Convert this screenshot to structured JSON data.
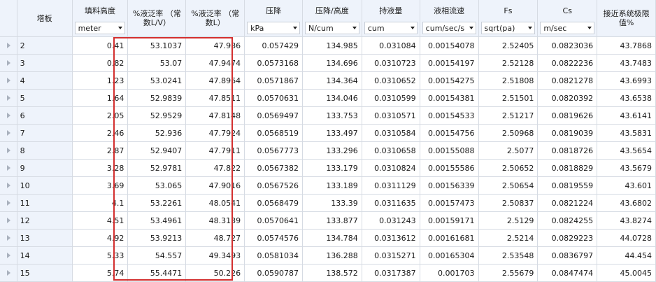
{
  "columns": [
    {
      "key": "stage",
      "title": "塔板",
      "unit": ""
    },
    {
      "key": "height",
      "title": "填料高度",
      "unit": "meter"
    },
    {
      "key": "flood1",
      "title": "%液泛率 （常数L/V）",
      "unit": ""
    },
    {
      "key": "flood2",
      "title": "%液泛率 （常数L）",
      "unit": ""
    },
    {
      "key": "dp",
      "title": "压降",
      "unit": "kPa"
    },
    {
      "key": "dph",
      "title": "压降/高度",
      "unit": "N/cum"
    },
    {
      "key": "holdup",
      "title": "持液量",
      "unit": "cum"
    },
    {
      "key": "liqv",
      "title": "液相流速",
      "unit": "cum/sec/s"
    },
    {
      "key": "fs",
      "title": "Fs",
      "unit": "sqrt(pa)"
    },
    {
      "key": "cs",
      "title": "Cs",
      "unit": "m/sec"
    },
    {
      "key": "approach",
      "title": "接近系统极限值%",
      "unit": ""
    }
  ],
  "rows": [
    [
      "2",
      "0.41",
      "53.1037",
      "47.986",
      "0.057429",
      "134.985",
      "0.031084",
      "0.00154078",
      "2.52405",
      "0.0823036",
      "43.7868"
    ],
    [
      "3",
      "0.82",
      "53.07",
      "47.9474",
      "0.0573168",
      "134.696",
      "0.0310723",
      "0.00154197",
      "2.52128",
      "0.0822236",
      "43.7483"
    ],
    [
      "4",
      "1.23",
      "53.0241",
      "47.8964",
      "0.0571867",
      "134.364",
      "0.0310652",
      "0.00154275",
      "2.51808",
      "0.0821278",
      "43.6993"
    ],
    [
      "5",
      "1.64",
      "52.9839",
      "47.8511",
      "0.0570631",
      "134.046",
      "0.0310599",
      "0.00154381",
      "2.51501",
      "0.0820392",
      "43.6538"
    ],
    [
      "6",
      "2.05",
      "52.9529",
      "47.8148",
      "0.0569497",
      "133.753",
      "0.0310571",
      "0.00154533",
      "2.51217",
      "0.0819626",
      "43.6141"
    ],
    [
      "7",
      "2.46",
      "52.936",
      "47.7924",
      "0.0568519",
      "133.497",
      "0.0310584",
      "0.00154756",
      "2.50968",
      "0.0819039",
      "43.5831"
    ],
    [
      "8",
      "2.87",
      "52.9407",
      "47.7911",
      "0.0567773",
      "133.296",
      "0.0310658",
      "0.00155088",
      "2.5077",
      "0.0818726",
      "43.5654"
    ],
    [
      "9",
      "3.28",
      "52.9781",
      "47.822",
      "0.0567382",
      "133.179",
      "0.0310824",
      "0.00155586",
      "2.50652",
      "0.0818829",
      "43.5679"
    ],
    [
      "10",
      "3.69",
      "53.065",
      "47.9016",
      "0.0567526",
      "133.189",
      "0.0311129",
      "0.00156339",
      "2.50654",
      "0.0819559",
      "43.601"
    ],
    [
      "11",
      "4.1",
      "53.2261",
      "48.0541",
      "0.0568479",
      "133.39",
      "0.0311635",
      "0.00157473",
      "2.50837",
      "0.0821224",
      "43.6802"
    ],
    [
      "12",
      "4.51",
      "53.4961",
      "48.3139",
      "0.0570641",
      "133.877",
      "0.031243",
      "0.00159171",
      "2.5129",
      "0.0824255",
      "43.8274"
    ],
    [
      "13",
      "4.92",
      "53.9213",
      "48.727",
      "0.0574576",
      "134.784",
      "0.0313612",
      "0.00161681",
      "2.5214",
      "0.0829223",
      "44.0728"
    ],
    [
      "14",
      "5.33",
      "54.557",
      "49.3493",
      "0.0581034",
      "136.288",
      "0.0315271",
      "0.00165304",
      "2.53548",
      "0.0836797",
      "44.454"
    ],
    [
      "15",
      "5.74",
      "55.4471",
      "50.226",
      "0.0590787",
      "138.572",
      "0.0317387",
      "0.001703",
      "2.55679",
      "0.0847474",
      "45.0045"
    ]
  ],
  "colors": {
    "header_bg": "#eef3fb",
    "grid": "#d6dbe3",
    "selection": "#d32f2f"
  }
}
